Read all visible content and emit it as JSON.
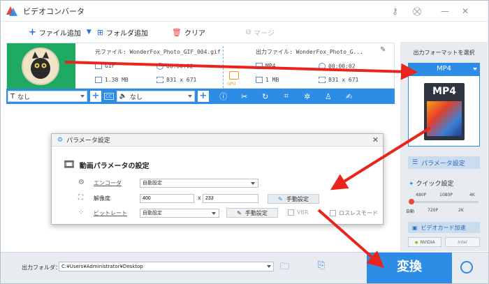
{
  "app": {
    "title": "ビデオコンバータ"
  },
  "toolbar": {
    "add_file": "ファイル追加",
    "add_folder": "フォルダ追加",
    "clear": "クリア",
    "merge": "マージ"
  },
  "file": {
    "source_label": "元ファイル:",
    "source_name": "WonderFox_Photo_GIF_004.gif",
    "source_format": "GIF",
    "source_duration": "00:00:02",
    "source_size": "1.38 MB",
    "source_resolution": "831 x 671",
    "output_label": "出力ファイル:",
    "output_name": "WonderFox_Photo_G...",
    "output_format": "MP4",
    "output_duration": "00:00:02",
    "output_size": "1 MB",
    "output_resolution": "831 x 671",
    "gpu_label": "GPU"
  },
  "editbar": {
    "subtitle": "なし",
    "audio": "なし"
  },
  "right_panel": {
    "select_format_label": "出力フォーマットを選択",
    "format": "MP4",
    "format_icon_text": "MP4",
    "params_button": "パラメータ設定",
    "quick_settings": "クイック設定",
    "quality_ticks_top": [
      "480P",
      "1080P",
      "4K"
    ],
    "quality_ticks_bottom": [
      "自動",
      "720P",
      "2K"
    ],
    "hw_accel": "ビデオカード加速",
    "chip_nvidia": "NVIDIA",
    "chip_intel": "Intel"
  },
  "dialog": {
    "title": "パラメータ設定",
    "heading": "動画パラメータの設定",
    "encoder_label": "エンコーダ",
    "encoder_value": "自動設定",
    "resolution_label": "解像度",
    "width": "400",
    "x_sep": "x",
    "height": "233",
    "manual_button": "手動設定",
    "bitrate_label": "ビットレート",
    "bitrate_value": "自動設定",
    "manual_button2": "手動設定",
    "vbr_label": "VBR",
    "lossless_label": "ロスレスモード"
  },
  "bottom": {
    "output_folder_label": "出力フォルダ：",
    "output_path": "C:¥Users¥Administrator¥Desktop",
    "convert": "変換"
  },
  "colors": {
    "accent": "#2d8ce6",
    "arrow": "#e8241c",
    "thumb_bg": "#1faa63"
  }
}
